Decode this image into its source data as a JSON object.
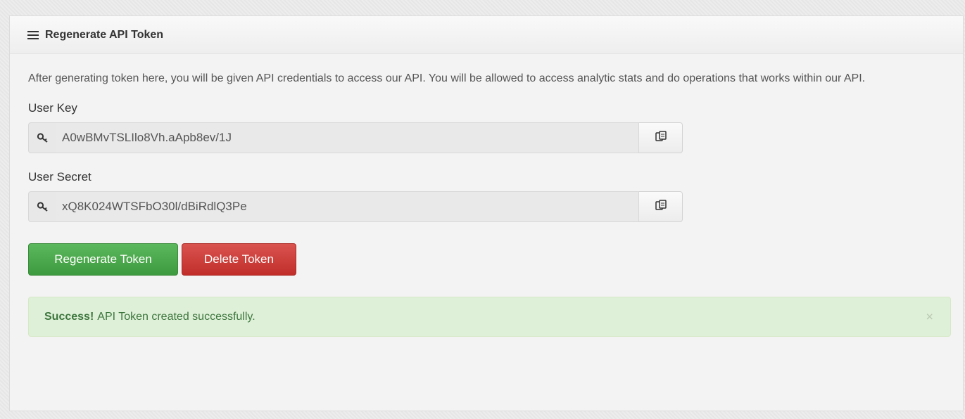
{
  "panel": {
    "title": "Regenerate API Token",
    "icon": "hamburger-icon"
  },
  "description": "After generating token here, you will be given API credentials to access our API. You will be allowed to access analytic stats and do operations that works within our API.",
  "user_key": {
    "label": "User Key",
    "value": "A0wBMvTSLIlo8Vh.aApb8ev/1J",
    "icon": "key-icon",
    "copy_icon": "copy-icon"
  },
  "user_secret": {
    "label": "User Secret",
    "value": "xQ8K024WTSFbO30l/dBiRdlQ3Pe",
    "icon": "key-icon",
    "copy_icon": "copy-icon"
  },
  "buttons": {
    "regenerate": "Regenerate Token",
    "delete": "Delete Token"
  },
  "alert": {
    "strong": "Success!",
    "message": "API Token created successfully.",
    "close": "×"
  },
  "colors": {
    "success_button": "#5cb85c",
    "danger_button": "#d9534f",
    "alert_background": "#dff0d8",
    "alert_text": "#3c763d"
  }
}
